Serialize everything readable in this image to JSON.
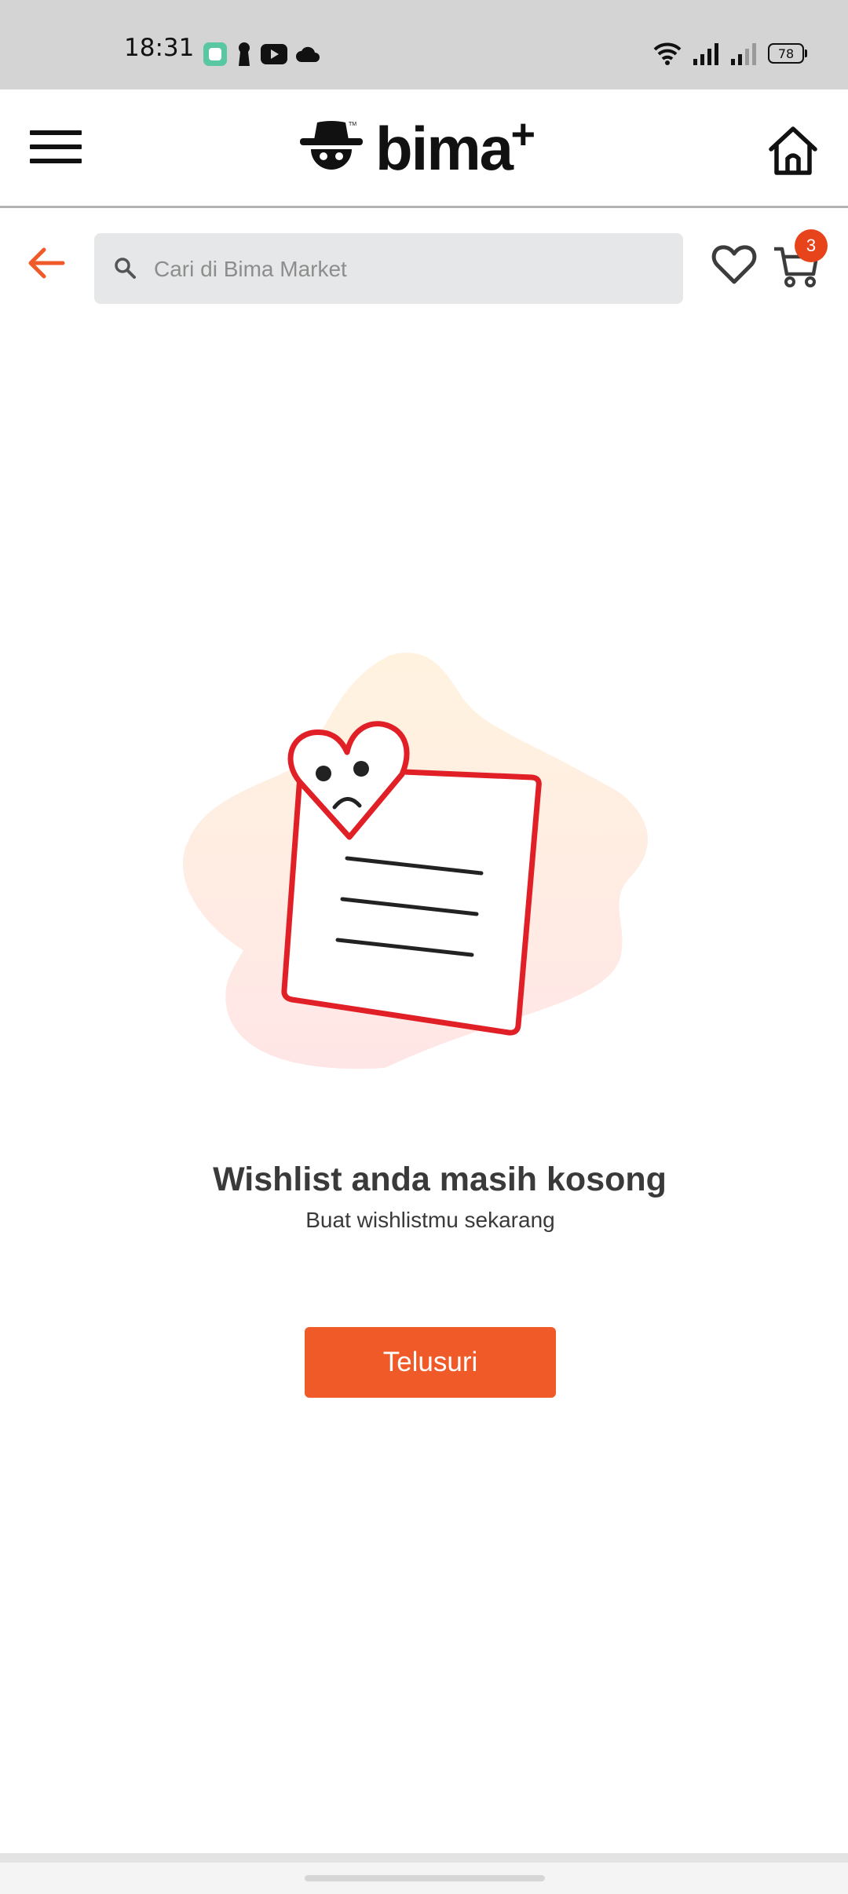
{
  "status_bar": {
    "time": "18:31",
    "battery": "78",
    "left_icons": [
      "chat-app-icon",
      "keyhole-icon",
      "youtube-icon",
      "cloud-icon"
    ],
    "right_icons": [
      "wifi-icon",
      "signal-icon",
      "signal-weak-icon",
      "battery-icon"
    ]
  },
  "app_bar": {
    "logo_text": "bima",
    "logo_plus": "+",
    "menu_icon": "hamburger-menu-icon",
    "home_icon": "home-icon"
  },
  "search_bar": {
    "placeholder": "Cari di Bima Market",
    "back_icon": "arrow-left-icon",
    "wishlist_icon": "heart-outline-icon",
    "cart_icon": "cart-icon",
    "cart_count": "3"
  },
  "empty_state": {
    "title": "Wishlist anda masih kosong",
    "subtitle": "Buat wishlistmu sekarang",
    "button_label": "Telusuri",
    "illustration": "sad-heart-document"
  },
  "colors": {
    "accent": "#f05a28",
    "badge": "#e8441c",
    "illustration_red": "#e11f26",
    "status_bar_bg": "#d4d4d4",
    "search_bg": "#e6e7e8"
  }
}
